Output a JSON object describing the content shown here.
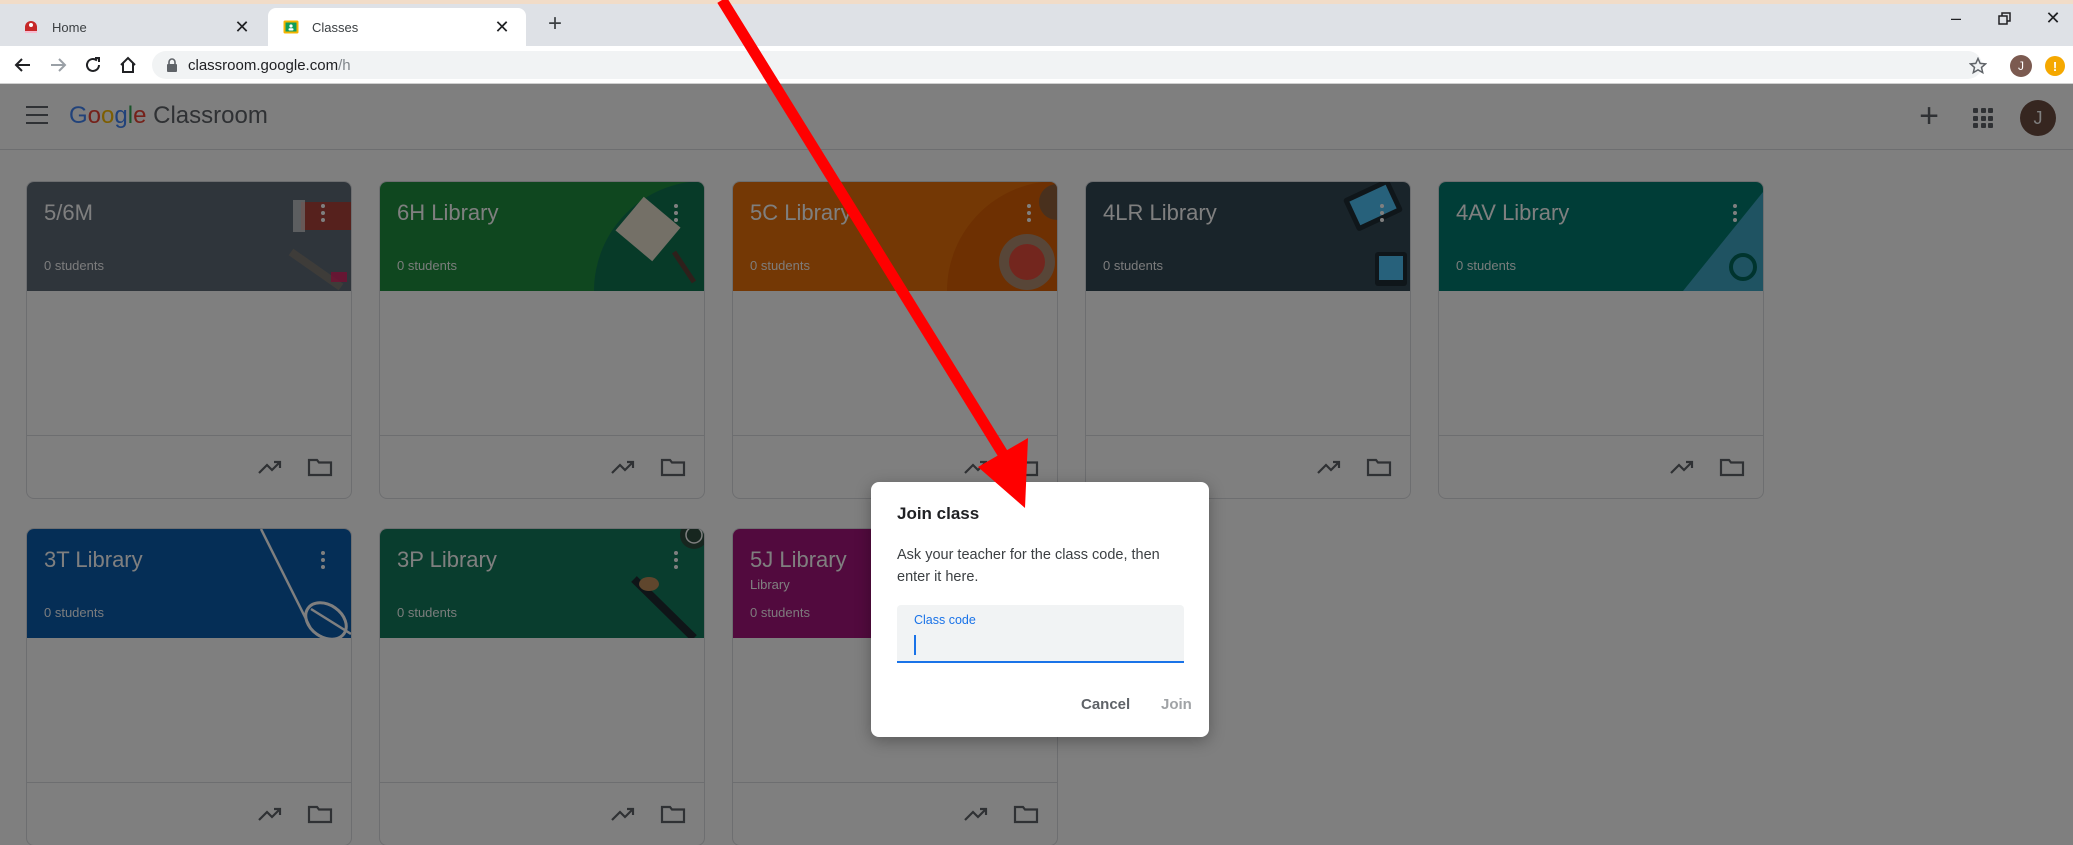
{
  "browser": {
    "tabs": [
      {
        "title": "Home",
        "active": false
      },
      {
        "title": "Classes",
        "active": true
      }
    ],
    "url_host": "classroom.google.com",
    "url_path": "/h",
    "profile_initial": "J"
  },
  "app": {
    "brand_google": [
      "G",
      "o",
      "o",
      "g",
      "l",
      "e"
    ],
    "brand_google_colors": [
      "#4285f4",
      "#ea4335",
      "#fbbc05",
      "#4285f4",
      "#34a853",
      "#ea4335"
    ],
    "brand_product": "Classroom",
    "account_initial": "J"
  },
  "classes": [
    {
      "name": "5/6M",
      "subtitle": "",
      "students": "0 students",
      "color": "#5f6b77"
    },
    {
      "name": "6H Library",
      "subtitle": "",
      "students": "0 students",
      "color": "#1e8e3e"
    },
    {
      "name": "5C Library",
      "subtitle": "",
      "students": "0 students",
      "color": "#e8710a"
    },
    {
      "name": "4LR Library",
      "subtitle": "",
      "students": "0 students",
      "color": "#334955"
    },
    {
      "name": "4AV Library",
      "subtitle": "",
      "students": "0 students",
      "color": "#007b6e"
    },
    {
      "name": "3T Library",
      "subtitle": "",
      "students": "0 students",
      "color": "#0b5cad"
    },
    {
      "name": "3P Library",
      "subtitle": "",
      "students": "0 students",
      "color": "#137a5c"
    },
    {
      "name": "5J Library",
      "subtitle": "Library",
      "students": "0 students",
      "color": "#a5147d"
    }
  ],
  "dialog": {
    "title": "Join class",
    "description": "Ask your teacher for the class code, then enter it here.",
    "field_label": "Class code",
    "field_value": "",
    "cancel_label": "Cancel",
    "join_label": "Join"
  },
  "annotation": {
    "arrow_color": "#ff0000"
  }
}
